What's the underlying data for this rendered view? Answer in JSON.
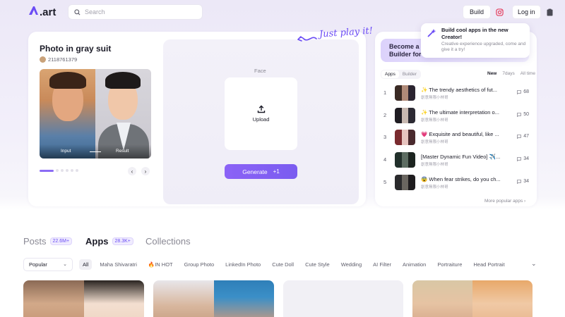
{
  "header": {
    "logo_text": ".art",
    "search_placeholder": "Search",
    "build_label": "Build",
    "login_label": "Log in"
  },
  "hero": {
    "title": "Photo in gray suit",
    "user_id": "2118761379",
    "input_label": "Input",
    "result_label": "Result",
    "face_label": "Face",
    "upload_label": "Upload",
    "generate_label": "Generate",
    "generate_cost": "+1",
    "slide_count": 6,
    "active_slide": 1
  },
  "tagline": "Just play it!",
  "popup": {
    "title": "Build cool apps in the new Creator!",
    "subtitle": "Creative experience upgraded, come and give it a try!"
  },
  "become_banner": "Become a Builder for",
  "ranking": {
    "tabs": [
      "Apps",
      "Builder"
    ],
    "active_tab": "Apps",
    "filters": [
      "New",
      "7days",
      "All time"
    ],
    "active_filter": "New",
    "rows": [
      {
        "rank": "1",
        "title": "✨ The trendy aesthetics of fut...",
        "author": "創意無限小林哥",
        "count": "68"
      },
      {
        "rank": "2",
        "title": "✨ The ultimate interpretation o...",
        "author": "創意無限小林哥",
        "count": "50"
      },
      {
        "rank": "3",
        "title": "💗 Exquisite and beautiful, like ...",
        "author": "創意無限小林哥",
        "count": "47"
      },
      {
        "rank": "4",
        "title": "[Master Dynamic Fun Video] ✈️...",
        "author": "創意無限小林哥",
        "count": "34"
      },
      {
        "rank": "5",
        "title": "😨 When fear strikes, do you ch...",
        "author": "創意無限小林哥",
        "count": "34"
      }
    ],
    "more_label": "More popular apps"
  },
  "sections": {
    "posts_label": "Posts",
    "posts_count": "22.6M+",
    "apps_label": "Apps",
    "apps_count": "28.3K+",
    "collections_label": "Collections"
  },
  "sort_select": "Popular",
  "chips": [
    "All",
    "Maha Shivaratri",
    "🔥IN HOT",
    "Group Photo",
    "LinkedIn Photo",
    "Cute Doll",
    "Cute Style",
    "Wedding",
    "AI Filter",
    "Animation",
    "Portraiture",
    "Head Portrait"
  ],
  "active_chip": "All",
  "colors": {
    "accent": "#7a5cf0",
    "accent_light": "#f0ecfe"
  }
}
